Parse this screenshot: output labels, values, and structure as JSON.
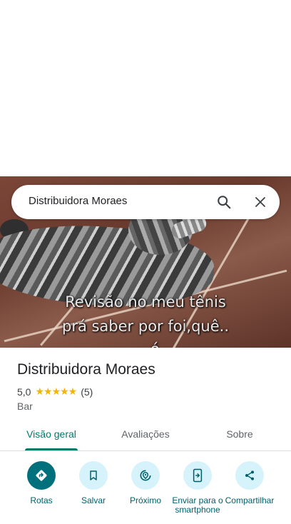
{
  "search": {
    "query": "Distribuidora Moraes"
  },
  "photo": {
    "caption_line1": "Revisão no meu tênis",
    "caption_line2": "prá saber por foi,quê..",
    "caption_line3": "       ó      ,   "
  },
  "place": {
    "name": "Distribuidora Moraes",
    "rating": "5,0",
    "stars": "★★★★★",
    "review_count": "(5)",
    "category": "Bar"
  },
  "tabs": [
    {
      "label": "Visão geral",
      "active": true
    },
    {
      "label": "Avaliações",
      "active": false
    },
    {
      "label": "Sobre",
      "active": false
    }
  ],
  "actions": [
    {
      "label": "Rotas",
      "icon": "directions-icon"
    },
    {
      "label": "Salvar",
      "icon": "bookmark-icon"
    },
    {
      "label": "Próximo",
      "icon": "nearby-icon"
    },
    {
      "label": "Enviar para o smartphone",
      "icon": "send-to-phone-icon"
    },
    {
      "label": "Compartilhar",
      "icon": "share-icon"
    }
  ],
  "colors": {
    "accent": "#00796b",
    "action_bg": "#d6f3fb",
    "primary_action": "#00707c",
    "star": "#f4b400"
  }
}
